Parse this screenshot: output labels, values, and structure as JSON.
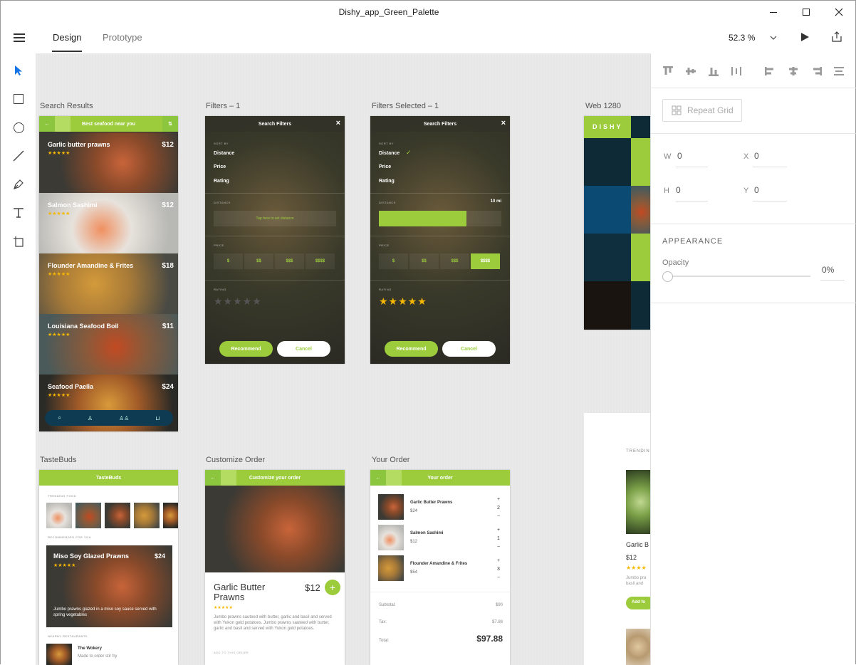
{
  "window": {
    "title": "Dishy_app_Green_Palette"
  },
  "menu": {
    "tabs": [
      {
        "label": "Design"
      },
      {
        "label": "Prototype"
      }
    ],
    "zoom": "52.3 %"
  },
  "tools": [
    "select-icon",
    "rectangle-icon",
    "ellipse-icon",
    "line-icon",
    "pen-icon",
    "text-icon",
    "artboard-icon"
  ],
  "artboards": {
    "search": {
      "label": "Search Results",
      "header": "Best seafood near you",
      "items": [
        {
          "name": "Garlic butter prawns",
          "price": "$12"
        },
        {
          "name": "Salmon Sashimi",
          "price": "$12"
        },
        {
          "name": "Flounder Amandine & Frites",
          "price": "$18"
        },
        {
          "name": "Louisiana Seafood Boil",
          "price": "$11"
        },
        {
          "name": "Seafood Paella",
          "price": "$24"
        }
      ]
    },
    "filters": {
      "label": "Filters – 1",
      "header": "Search Filters",
      "sort_by": "SORT BY",
      "options": [
        "Distance",
        "Price",
        "Rating"
      ],
      "distance": "DISTANCE",
      "distance_hint": "Tap here to set distance",
      "price": "PRICE",
      "prices": [
        "$",
        "$$",
        "$$$",
        "$$$$"
      ],
      "rating": "RATING",
      "recommend": "Recommend",
      "cancel": "Cancel"
    },
    "filters_selected": {
      "label": "Filters Selected – 1",
      "header": "Search Filters",
      "sort_by": "SORT BY",
      "options": [
        "Distance",
        "Price",
        "Rating"
      ],
      "distance": "DISTANCE",
      "distance_value": "10 mi",
      "price": "PRICE",
      "prices": [
        "$",
        "$$",
        "$$$",
        "$$$$"
      ],
      "rating": "RATING",
      "recommend": "Recommend",
      "cancel": "Cancel"
    },
    "web": {
      "label": "Web 1280",
      "brand": "DISHY",
      "trending": "TRENDIN",
      "dish": "Garlic B",
      "price": "$12",
      "desc1": "Jumbo pra",
      "desc2": "basil and",
      "add": "Add fo"
    },
    "tastebuds": {
      "label": "TasteBuds",
      "header": "TasteBuds",
      "trending": "TRENDING FOOD",
      "recommended": "RECOMMENDED FOR YOU",
      "feature_title": "Miso Soy Glazed Prawns",
      "feature_price": "$24",
      "feature_desc": "Jumbo prawns glazed in a miso soy sauce served with spring vegetables",
      "nearby": "NEARBY RESTAURANTS",
      "restaurant": "The Wokery",
      "restaurant_desc": "Made to order stir fry"
    },
    "customize": {
      "label": "Customize Order",
      "header": "Customize your order",
      "dish": "Garlic Butter Prawns",
      "price": "$12",
      "desc": "Jumbo prawns sauteed with butter, garlic and basil and served with Yukon gold potatoes. Jumbo prawns sauteed with butter, garlic and basil and served with Yukon gold potatoes.",
      "add_label": "ADD TO THIS ORDER"
    },
    "order": {
      "label": "Your Order",
      "header": "Your order",
      "items": [
        {
          "name": "Garlic Butter Prawns",
          "price": "$24",
          "qty": "2"
        },
        {
          "name": "Salmon Sashimi",
          "price": "$12",
          "qty": "1"
        },
        {
          "name": "Flounder Amandine & Frites",
          "price": "$54",
          "qty": "3"
        }
      ],
      "subtotal_label": "Subtotal:",
      "subtotal": "$90",
      "tax_label": "Tax:",
      "tax": "$7.88",
      "total_label": "Total:",
      "total": "$97.88"
    }
  },
  "panel": {
    "repeat_grid": "Repeat Grid",
    "w_label": "W",
    "w": "0",
    "x_label": "X",
    "x": "0",
    "h_label": "H",
    "h": "0",
    "y_label": "Y",
    "y": "0",
    "appearance": "APPEARANCE",
    "opacity_label": "Opacity",
    "opacity": "0%"
  },
  "colors": {
    "accent": "#9ccc3c",
    "star": "#f5b700",
    "nav": "#0e3a52"
  }
}
